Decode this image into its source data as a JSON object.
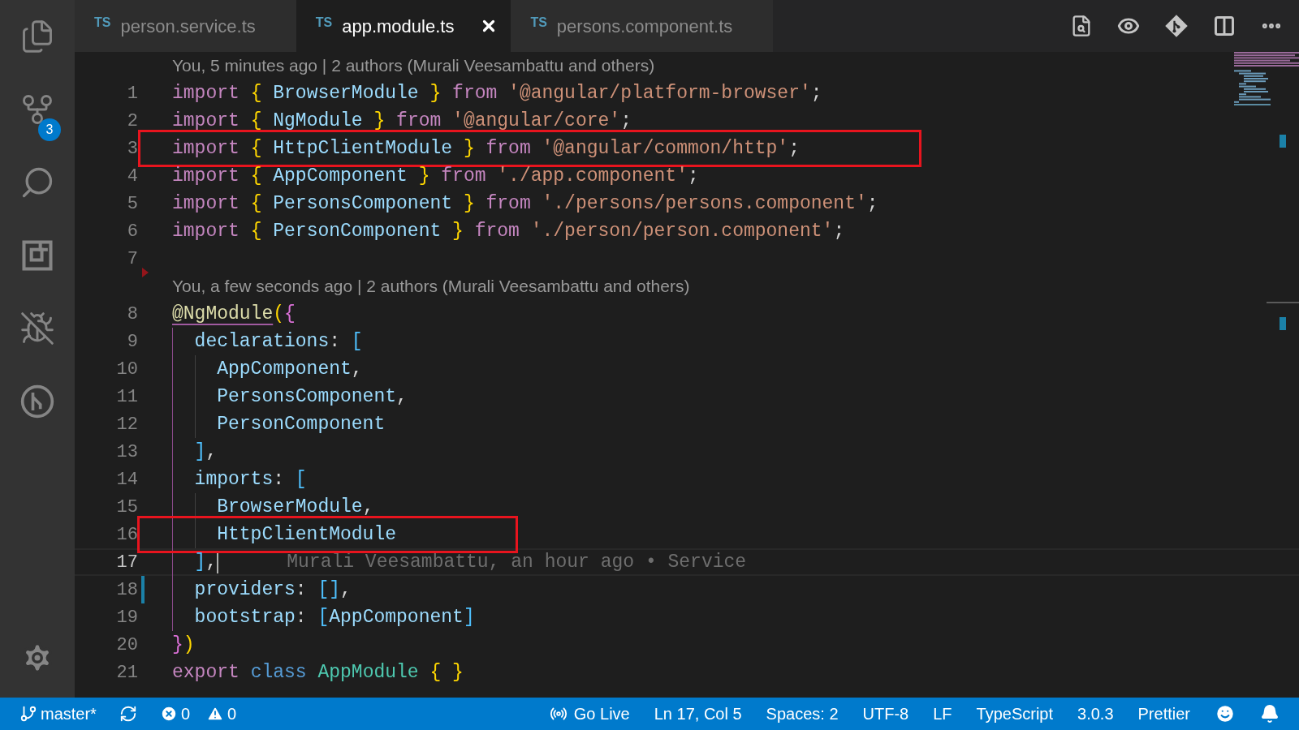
{
  "activity_bar": {
    "items": [
      {
        "kind": "files"
      },
      {
        "kind": "source-control",
        "badge": "3"
      },
      {
        "kind": "search"
      },
      {
        "kind": "extensions"
      },
      {
        "kind": "debug"
      },
      {
        "kind": "remote"
      }
    ]
  },
  "tabs": [
    {
      "lang": "TS",
      "label": "person.service.ts",
      "selected": false
    },
    {
      "lang": "TS",
      "label": "app.module.ts",
      "selected": true
    },
    {
      "lang": "TS",
      "label": "persons.component.ts",
      "selected": false
    }
  ],
  "editor": {
    "lines": [
      {
        "kind": "codelens",
        "text": "You, 5 minutes ago | 2 authors (Murali Veesambattu and others)"
      },
      {
        "kind": "code",
        "number": "1",
        "boxed": false,
        "current": false,
        "tokens": [
          {
            "kind": "kw",
            "text": "import "
          },
          {
            "kind": "br",
            "text": "{"
          },
          {
            "kind": "id",
            "text": " BrowserModule "
          },
          {
            "kind": "br",
            "text": "} "
          },
          {
            "kind": "kw",
            "text": "from "
          },
          {
            "kind": "str",
            "text": "'@angular/platform-browser'"
          },
          {
            "kind": "p",
            "text": ";"
          }
        ]
      },
      {
        "kind": "code",
        "number": "2",
        "boxed": false,
        "current": false,
        "tokens": [
          {
            "kind": "kw",
            "text": "import "
          },
          {
            "kind": "br",
            "text": "{"
          },
          {
            "kind": "id",
            "text": " NgModule "
          },
          {
            "kind": "br",
            "text": "} "
          },
          {
            "kind": "kw",
            "text": "from "
          },
          {
            "kind": "str",
            "text": "'@angular/core'"
          },
          {
            "kind": "p",
            "text": ";"
          }
        ]
      },
      {
        "kind": "code",
        "number": "3",
        "boxed": true,
        "current": false,
        "tokens": [
          {
            "kind": "kw",
            "text": "import "
          },
          {
            "kind": "br",
            "text": "{"
          },
          {
            "kind": "id",
            "text": " HttpClientModule "
          },
          {
            "kind": "br",
            "text": "} "
          },
          {
            "kind": "kw",
            "text": "from "
          },
          {
            "kind": "str",
            "text": "'@angular/common/http'"
          },
          {
            "kind": "p",
            "text": ";"
          }
        ]
      },
      {
        "kind": "code",
        "number": "4",
        "boxed": false,
        "current": false,
        "tokens": [
          {
            "kind": "kw",
            "text": "import "
          },
          {
            "kind": "br",
            "text": "{"
          },
          {
            "kind": "id",
            "text": " AppComponent "
          },
          {
            "kind": "br",
            "text": "} "
          },
          {
            "kind": "kw",
            "text": "from "
          },
          {
            "kind": "str",
            "text": "'./app.component'"
          },
          {
            "kind": "p",
            "text": ";"
          }
        ]
      },
      {
        "kind": "code",
        "number": "5",
        "boxed": false,
        "current": false,
        "tokens": [
          {
            "kind": "kw",
            "text": "import "
          },
          {
            "kind": "br",
            "text": "{"
          },
          {
            "kind": "id",
            "text": " PersonsComponent "
          },
          {
            "kind": "br",
            "text": "} "
          },
          {
            "kind": "kw",
            "text": "from "
          },
          {
            "kind": "str",
            "text": "'./persons/persons.component'"
          },
          {
            "kind": "p",
            "text": ";"
          }
        ]
      },
      {
        "kind": "code",
        "number": "6",
        "boxed": false,
        "current": false,
        "tokens": [
          {
            "kind": "kw",
            "text": "import "
          },
          {
            "kind": "br",
            "text": "{"
          },
          {
            "kind": "id",
            "text": " PersonComponent "
          },
          {
            "kind": "br",
            "text": "} "
          },
          {
            "kind": "kw",
            "text": "from "
          },
          {
            "kind": "str",
            "text": "'./person/person.component'"
          },
          {
            "kind": "p",
            "text": ";"
          }
        ]
      },
      {
        "kind": "code",
        "number": "7",
        "boxed": false,
        "current": false,
        "deleted": true
      },
      {
        "kind": "codelens",
        "text": "You, a few seconds ago | 2 authors (Murali Veesambattu and others)"
      },
      {
        "kind": "code",
        "number": "8",
        "boxed": false,
        "current": false,
        "tokens": [
          {
            "kind": "dec",
            "text": "@NgModule"
          },
          {
            "kind": "br",
            "text": "("
          },
          {
            "kind": "br2",
            "text": "{"
          }
        ]
      },
      {
        "kind": "code",
        "number": "9",
        "boxed": false,
        "current": false,
        "tokens": [
          {
            "kind": "id",
            "text": "  declarations"
          },
          {
            "kind": "p",
            "text": ": "
          },
          {
            "kind": "br3",
            "text": "["
          }
        ]
      },
      {
        "kind": "code",
        "number": "10",
        "boxed": false,
        "current": false,
        "tokens": [
          {
            "kind": "id",
            "text": "    AppComponent"
          },
          {
            "kind": "p",
            "text": ","
          }
        ]
      },
      {
        "kind": "code",
        "number": "11",
        "boxed": false,
        "current": false,
        "tokens": [
          {
            "kind": "id",
            "text": "    PersonsComponent"
          },
          {
            "kind": "p",
            "text": ","
          }
        ]
      },
      {
        "kind": "code",
        "number": "12",
        "boxed": false,
        "current": false,
        "tokens": [
          {
            "kind": "id",
            "text": "    PersonComponent"
          }
        ]
      },
      {
        "kind": "code",
        "number": "13",
        "boxed": false,
        "current": false,
        "tokens": [
          {
            "kind": "br3",
            "text": "  ]"
          },
          {
            "kind": "p",
            "text": ","
          }
        ]
      },
      {
        "kind": "code",
        "number": "14",
        "boxed": false,
        "current": false,
        "tokens": [
          {
            "kind": "id",
            "text": "  imports"
          },
          {
            "kind": "p",
            "text": ": "
          },
          {
            "kind": "br3",
            "text": "["
          }
        ]
      },
      {
        "kind": "code",
        "number": "15",
        "boxed": false,
        "current": false,
        "tokens": [
          {
            "kind": "id",
            "text": "    BrowserModule"
          },
          {
            "kind": "p",
            "text": ","
          }
        ]
      },
      {
        "kind": "code",
        "number": "16",
        "boxed": true,
        "current": false,
        "tokens": [
          {
            "kind": "id",
            "text": "    HttpClientModule"
          }
        ]
      },
      {
        "kind": "code",
        "number": "17",
        "boxed": false,
        "current": true,
        "blame": "Murali Veesambattu, an hour ago • Service",
        "tokens": [
          {
            "kind": "br3",
            "text": "  ]"
          },
          {
            "kind": "p",
            "text": ","
          }
        ]
      },
      {
        "kind": "code",
        "number": "18",
        "boxed": false,
        "current": false,
        "modified": true,
        "tokens": [
          {
            "kind": "id",
            "text": "  providers"
          },
          {
            "kind": "p",
            "text": ": "
          },
          {
            "kind": "br3",
            "text": "[]"
          },
          {
            "kind": "p",
            "text": ","
          }
        ]
      },
      {
        "kind": "code",
        "number": "19",
        "boxed": false,
        "current": false,
        "tokens": [
          {
            "kind": "id",
            "text": "  bootstrap"
          },
          {
            "kind": "p",
            "text": ": "
          },
          {
            "kind": "br3",
            "text": "["
          },
          {
            "kind": "id",
            "text": "AppComponent"
          },
          {
            "kind": "br3",
            "text": "]"
          }
        ]
      },
      {
        "kind": "code",
        "number": "20",
        "boxed": false,
        "current": false,
        "tokens": [
          {
            "kind": "br2",
            "text": "}"
          },
          {
            "kind": "br",
            "text": ")"
          }
        ]
      },
      {
        "kind": "code",
        "number": "21",
        "boxed": false,
        "current": false,
        "tokens": [
          {
            "kind": "kw",
            "text": "export "
          },
          {
            "kind": "st",
            "text": "class "
          },
          {
            "kind": "ty",
            "text": "AppModule "
          },
          {
            "kind": "br",
            "text": "{ }"
          }
        ]
      }
    ]
  },
  "status_bar": {
    "left": [
      {
        "kind": "branch",
        "text": "master*"
      },
      {
        "kind": "sync"
      },
      {
        "kind": "errors",
        "text": "0"
      },
      {
        "kind": "warnings",
        "text": "0"
      }
    ],
    "right": [
      {
        "kind": "live",
        "text": "Go Live"
      },
      {
        "kind": "text",
        "text": "Ln 17, Col 5"
      },
      {
        "kind": "text",
        "text": "Spaces: 2"
      },
      {
        "kind": "text",
        "text": "UTF-8"
      },
      {
        "kind": "text",
        "text": "LF"
      },
      {
        "kind": "text",
        "text": "TypeScript"
      },
      {
        "kind": "text",
        "text": "3.0.3"
      },
      {
        "kind": "text",
        "text": "Prettier"
      },
      {
        "kind": "feedback"
      },
      {
        "kind": "bell"
      }
    ]
  }
}
